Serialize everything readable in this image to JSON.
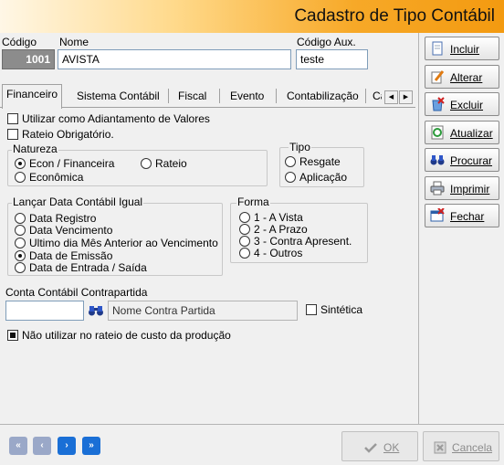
{
  "window": {
    "title": "Cadastro de Tipo Contábil"
  },
  "header": {
    "codigo_label": "Código",
    "codigo_value": "1001",
    "nome_label": "Nome",
    "nome_value": "AVISTA",
    "codigo_aux_label": "Código Aux.",
    "codigo_aux_value": "teste"
  },
  "tabs": [
    "Financeiro",
    "Sistema Contábil",
    "Fiscal",
    "Evento",
    "Contabilização",
    "Ca"
  ],
  "financeiro": {
    "adiantamento_label": "Utilizar como Adiantamento de Valores",
    "adiantamento_checked": false,
    "rateio_obrig_label": "Rateio Obrigatório.",
    "rateio_obrig_checked": false,
    "natureza": {
      "title": "Natureza",
      "options": [
        "Econ / Financeira",
        "Rateio",
        "Econômica"
      ],
      "selected": "Econ / Financeira"
    },
    "tipo": {
      "title": "Tipo",
      "options": [
        "Resgate",
        "Aplicação"
      ],
      "selected": null
    },
    "lancar": {
      "title": "Lançar Data Contábil Igual",
      "options": [
        "Data Registro",
        "Data Vencimento",
        "Ultimo dia Mês Anterior ao Vencimento",
        "Data de Emissão",
        "Data de Entrada / Saída"
      ],
      "selected": "Data de Emissão"
    },
    "forma": {
      "title": "Forma",
      "options": [
        "1 - A Vista",
        "2 - A Prazo",
        "3 - Contra Apresent.",
        "4 - Outros"
      ],
      "selected": null
    },
    "conta": {
      "label": "Conta Contábil Contrapartida",
      "value": "",
      "nome_placeholder": "Nome Contra Partida",
      "sintetica_label": "Sintética",
      "sintetica_checked": false
    },
    "nao_utilizar_label": "Não utilizar no rateio de custo da produção",
    "nao_utilizar_checked": true
  },
  "sidebar": {
    "buttons": [
      {
        "label": "Incluir",
        "icon": "new-document-icon"
      },
      {
        "label": "Alterar",
        "icon": "edit-pencil-icon"
      },
      {
        "label": "Excluir",
        "icon": "delete-icon"
      },
      {
        "label": "Atualizar",
        "icon": "refresh-icon"
      },
      {
        "label": "Procurar",
        "icon": "binoculars-icon"
      },
      {
        "label": "Imprimir",
        "icon": "printer-icon"
      },
      {
        "label": "Fechar",
        "icon": "close-window-icon"
      }
    ]
  },
  "footer": {
    "ok_label": "OK",
    "cancel_label": "Cancela"
  },
  "colors": {
    "title_gradient_end": "#f39a10",
    "nav_blue": "#1a6fd6",
    "nav_disabled": "#9aa8c8"
  }
}
